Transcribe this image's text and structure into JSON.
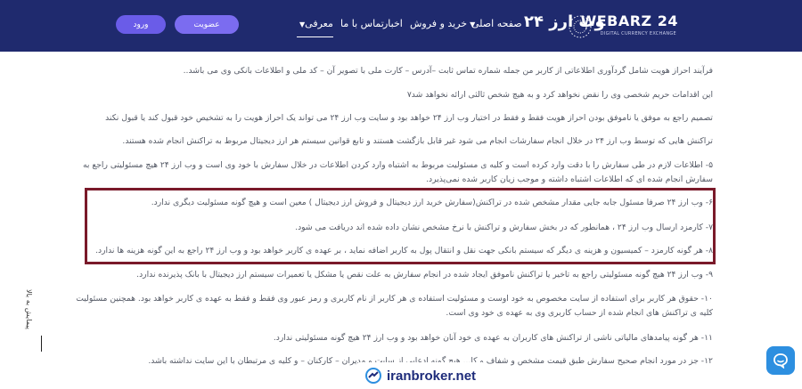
{
  "header": {
    "brand": "وب ارز ۲۴",
    "logo_text": "WEBARZ 24",
    "logo_sub": "DIGITAL CURRENCY EXCHANGE",
    "nav": [
      {
        "label": "صفحه اصلی",
        "has_dropdown": false
      },
      {
        "label": "خرید و فروش",
        "has_dropdown": true
      },
      {
        "label": "اخبار",
        "has_dropdown": false
      },
      {
        "label": "تماس با ما",
        "has_dropdown": false
      },
      {
        "label": "معرفی",
        "has_dropdown": true
      }
    ],
    "register_label": "عضویت",
    "login_label": "ورود"
  },
  "paragraphs": [
    "فرآیند احراز هویت شامل گردآوری اطلاعاتی از کاربر من جمله شماره تماس ثابت –آدرس – کارت ملی با تصویر آن – کد ملی و اطلاعات بانکی وی می باشد..",
    "این اقدامات حریم شخصی وی را نقض نخواهد کرد و به هیچ شخص ثالثی ارائه نخواهد شد۷",
    "تصمیم راجع به موفق یا ناموفق بودن احراز هویت فقط و فقط در اختیار وب ارز ۲۴ خواهد بود و سایت وب ارز ۲۴ می تواند یک احراز هویت را به تشخیص خود قبول کند یا قبول نکند",
    "تراکنش هایی که توسط وب ارز ۲۴ در خلال انجام سفارشات انجام می شود غیر قابل بازگشت هستند و تابع قوانین سیستم هر ارز دیجیتال مربوط به تراکنش انجام شده هستند.",
    "۵- اطلاعات لازم در طی سفارش را با دقت وارد کرده است و کلیه ی مسئولیت مربوط به اشتباه وارد کردن اطلاعات در خلال سفارش با خود وی است و وب ارز ۲۴ هیچ مسئولیتی راجع به سفارش انجام شده ای که اطلاعات اشتباه داشته و موجب زیان کاربر شده نمی‌پذیرد.",
    "۶- وب ارز ۲۴ صرفا مسئول جابه جایی مقدار مشخص شده در تراکنش(سفارش خرید ارز دیجیتال و فروش ارز دیجیتال ) معین است و هیچ گونه مسئولیت دیگری ندارد.",
    "۷- کارمزد ارسال وب ارز ۲۴ ، همانطور که در بخش سفارش و تراکنش با نرخ مشخص نشان داده شده اند دریافت می شود.",
    "۸- هر گونه کارمزد – کمیسیون و هزینه ی دیگر که سیستم بانکی جهت نقل و انتقال پول به کاربر اضافه نماید ، بر عهده ی کاربر خواهد بود و وب ارز ۲۴ راجع به این گونه هزینه ها ندارد.",
    "۹- وب ارز ۲۴ هیچ گونه مسئولیتی راجع به تاخیر یا تراکنش ناموفق ایجاد شده در انجام سفارش به علت نقص یا مشکل یا تعمیرات سیستم ارز دیجیتال با بانک پذیرنده ندارد.",
    "۱۰- حقوق هر کاربر برای استفاده از سایت مخصوص به خود اوست و مسئولیت استفاده ی هر کاربر از نام کاربری و رمز عبور وی فقط و فقط به عهده ی کاربر خواهد بود. همچنین مسئولیت کلیه ی تراکنش های انجام شده از حساب کاربری وی به عهده ی خود وی است.",
    "۱۱- هر گونه پیامدهای مالیاتی ناشی از تراکنش های کاربران به عهده ی خود آنان خواهد بود و وب ارز ۲۴ هیچ گونه مسئولیتی ندارد.",
    "۱۲- جز در مورد انجام صحیح سفارش طبق قیمت مشخص و شفاف و کا... هیچ گونه ادعایی از سایت و مدیران – کارکنان – و کلیه ی مرتبطان با این سایت نداشته باشد."
  ],
  "side_label": "پیمایش به بالا",
  "watermark": "iranbroker.net",
  "colors": {
    "header_bg": "#1f2a6e",
    "button": "#6a5ce8",
    "highlight_border": "#7a1a2a",
    "chat": "#2d8fe0"
  },
  "icons": [
    "chat-icon",
    "chevron-down-icon",
    "logo-icon",
    "watermark-logo-icon"
  ]
}
